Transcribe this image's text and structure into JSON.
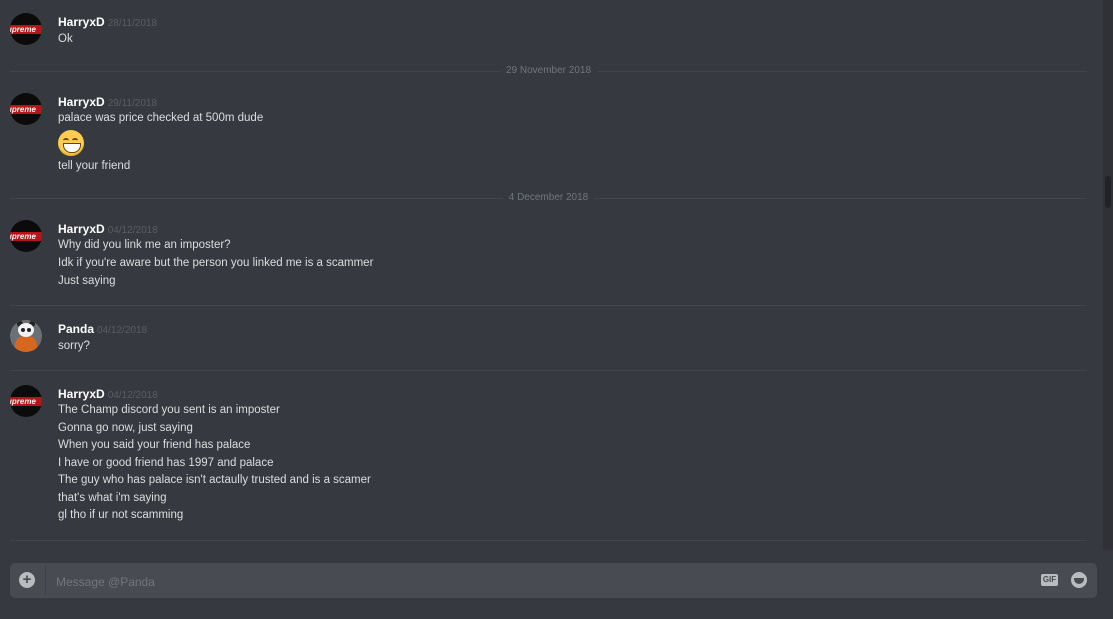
{
  "groups": [
    {
      "username": "HarryxD",
      "timestamp": "28/11/2018",
      "avatar": "supreme-avatar",
      "lines": [
        "Ok"
      ]
    },
    {
      "username": "HarryxD",
      "timestamp": "29/11/2018",
      "avatar": "supreme-avatar",
      "lines": [
        "palace was price checked at 500m dude",
        "tell your friend"
      ],
      "emoji": "grinning-face-emoji"
    },
    {
      "username": "HarryxD",
      "timestamp": "04/12/2018",
      "avatar": "supreme-avatar",
      "lines": [
        "Why did you link me an imposter?",
        "Idk if you're aware but the person you linked me is a scammer",
        "Just saying"
      ]
    },
    {
      "username": "Panda",
      "timestamp": "04/12/2018",
      "avatar": "panda-avatar",
      "lines": [
        "sorry?"
      ]
    },
    {
      "username": "HarryxD",
      "timestamp": "04/12/2018",
      "avatar": "supreme-avatar",
      "lines": [
        "The Champ discord you sent is an imposter",
        "Gonna go now, just saying",
        "When you said your friend has palace",
        "I have or good friend has 1997 and palace",
        "The guy who has palace isn't actaully trusted and is a scamer",
        "that's what i'm saying",
        "gl tho if ur not scamming"
      ]
    }
  ],
  "date_dividers": [
    "29 November 2018",
    "4 December 2018"
  ],
  "avatar_text": {
    "supreme": "upreme"
  },
  "composer": {
    "placeholder": "Message @Panda",
    "gif_label": "GIF",
    "icons": [
      "plus-circle-icon",
      "gif-icon",
      "emoji-icon"
    ]
  }
}
